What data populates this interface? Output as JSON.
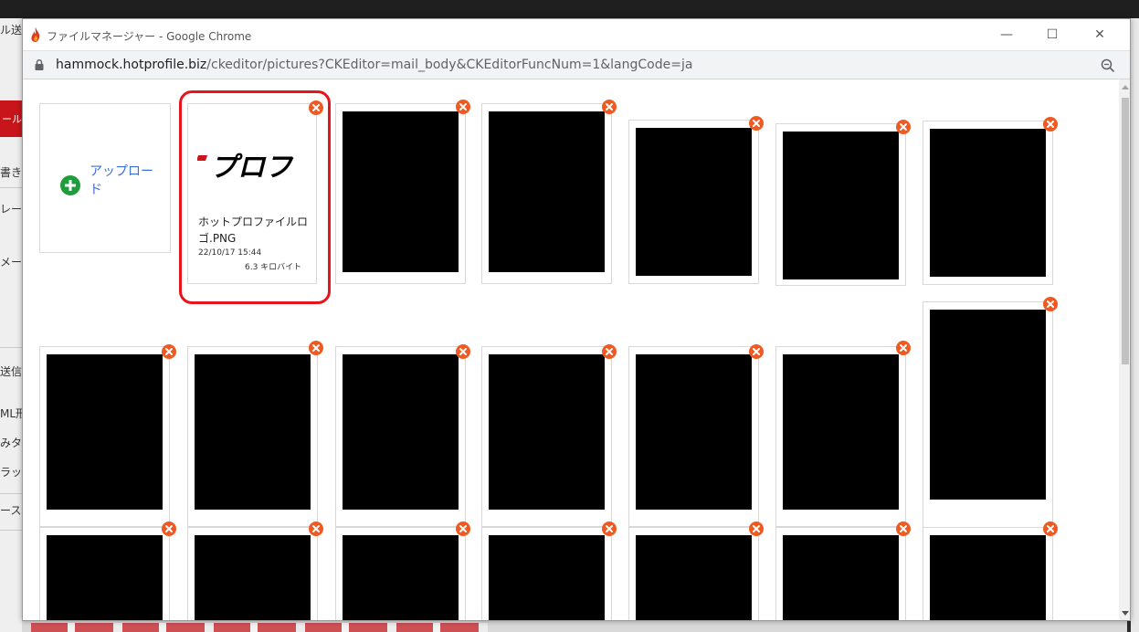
{
  "window": {
    "title": "ファイルマネージャー - Google Chrome",
    "url_host": "hammock.hotprofile.biz",
    "url_path": "/ckeditor/pictures?CKEditor=mail_body&CKEditorFuncNum=1&langCode=ja",
    "minimize": "—",
    "maximize": "☐",
    "close": "✕"
  },
  "background": {
    "fragments": [
      "ル送",
      "ール",
      "書き",
      "レー",
      "メー",
      "送信",
      "ML形",
      "みタ",
      "ラッ",
      "ース"
    ]
  },
  "file_manager": {
    "upload_label": "アップロード",
    "first_file": {
      "logo_text": "プロフ",
      "name": "ホットプロファイルロゴ.PNG",
      "date": "22/10/17 15:44",
      "size": "6.3 キロバイト"
    },
    "redacted_tiles_count": 20
  },
  "colors": {
    "delete_badge": "#f05a22",
    "upload_plus": "#1e9d3a",
    "upload_link": "#3a6fd8",
    "highlight": "#e8141c",
    "brand_red": "#c8151b"
  },
  "icons": [
    "app-flame-icon",
    "lock-icon",
    "zoom-icon",
    "plus-circle-icon",
    "delete-icon"
  ]
}
